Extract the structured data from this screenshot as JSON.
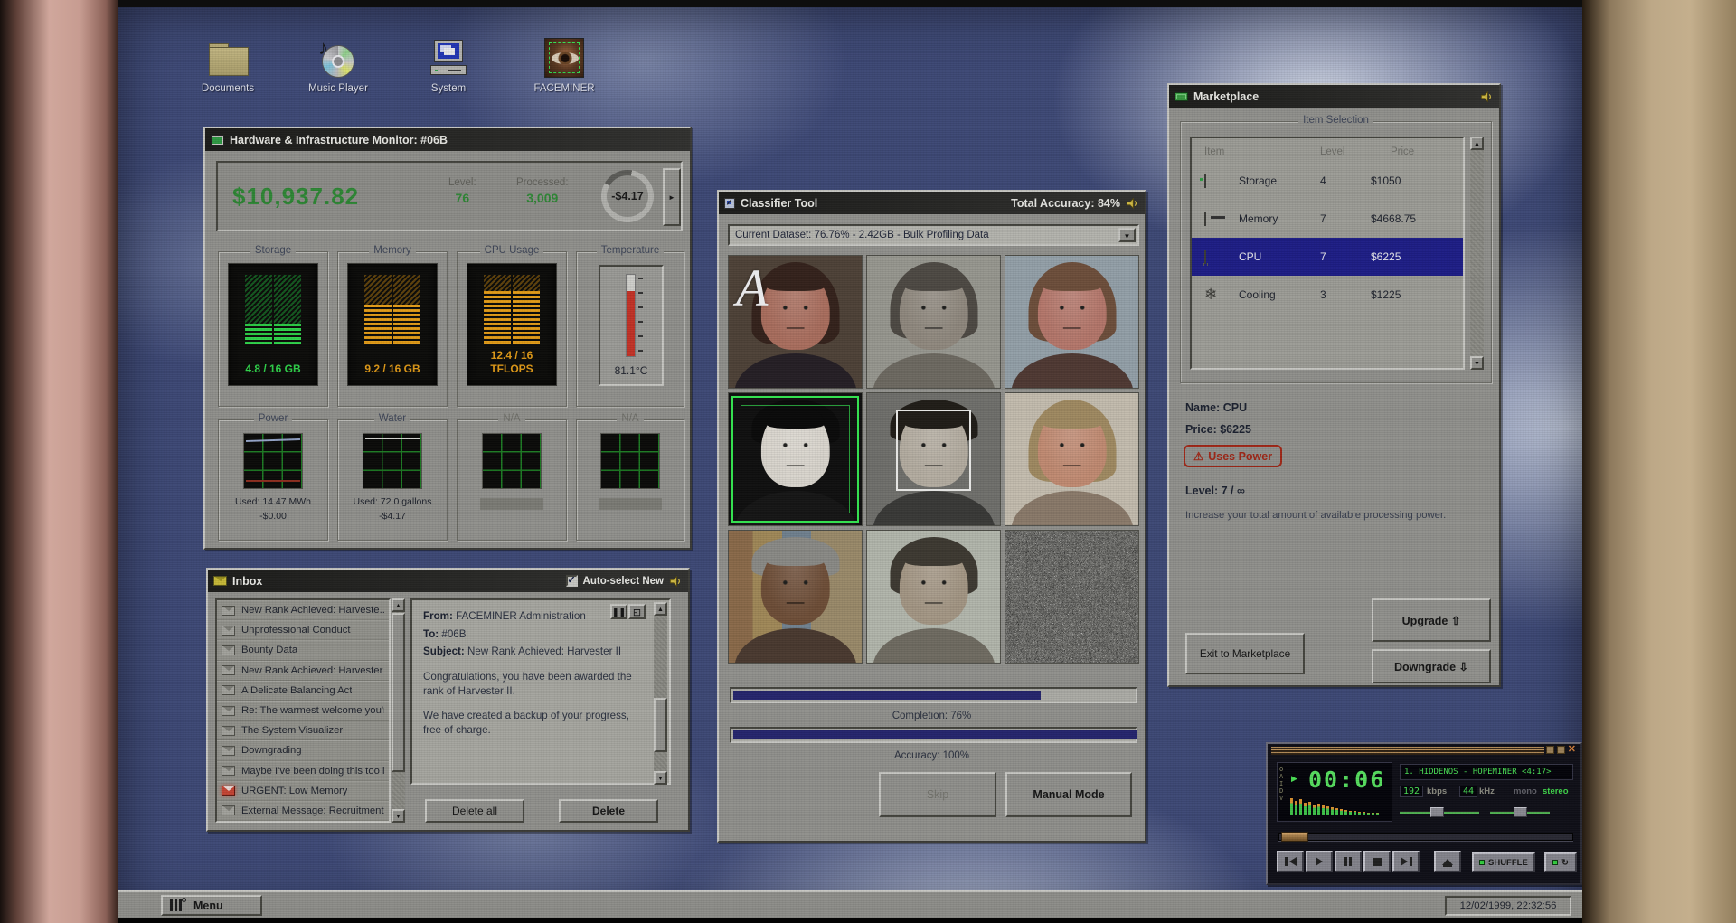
{
  "desktop": {
    "icons": [
      {
        "label": "Documents"
      },
      {
        "label": "Music Player"
      },
      {
        "label": "System"
      },
      {
        "label": "FACEMINER"
      }
    ]
  },
  "hardware": {
    "title": "Hardware & Infrastructure Monitor: #06B",
    "balance": "$10,937.82",
    "level_label": "Level:",
    "level": "76",
    "processed_label": "Processed:",
    "processed": "3,009",
    "rate": "-$4.17",
    "expand_arrow": "►",
    "gauges": [
      {
        "label": "Storage",
        "value": "4.8 / 16 GB"
      },
      {
        "label": "Memory",
        "value": "9.2 / 16 GB"
      },
      {
        "label": "CPU Usage",
        "value": "12.4 / 16",
        "unit": "TFLOPS"
      },
      {
        "label": "Temperature",
        "value": "81.1°C"
      }
    ],
    "meters": [
      {
        "label": "Power",
        "used": "Used: 14.47 MWh",
        "cost": "-$0.00"
      },
      {
        "label": "Water",
        "used": "Used: 72.0 gallons",
        "cost": "-$4.17"
      },
      {
        "label": "N/A"
      },
      {
        "label": "N/A"
      }
    ]
  },
  "inbox": {
    "title": "Inbox",
    "autoselect_label": "Auto-select New",
    "check_glyph": "✓",
    "emails": [
      "New Rank Achieved: Harveste...",
      "Unprofessional Conduct",
      "Bounty Data",
      "New Rank Achieved: Harvester I",
      "A Delicate Balancing Act",
      "Re: The warmest welcome you'r...",
      "The System Visualizer",
      "Downgrading",
      "Maybe I've been doing this too l...",
      "URGENT: Low Memory",
      "External Message: Recruitment"
    ],
    "message": {
      "from_label": "From:",
      "from": "FACEMINER Administration",
      "to_label": "To:",
      "to": "#06B",
      "subject_label": "Subject:",
      "subject": "New Rank Achieved: Harvester II",
      "body1": "Congratulations, you have been awarded the rank of Harvester II.",
      "body2": "We have created a backup of your progress, free of charge."
    },
    "pause_glyph": "❚❚",
    "delete_all": "Delete all",
    "delete": "Delete"
  },
  "classifier": {
    "title": "Classifier Tool",
    "total_accuracy": "Total Accuracy: 84%",
    "dataset": "Current Dataset: 76.76% - 2.42GB - Bulk Profiling Data",
    "drop_glyph": "▼",
    "overlay_letter": "A",
    "completion_label": "Completion: 76%",
    "accuracy_label": "Accuracy: 100%",
    "skip": "Skip",
    "manual_mode": "Manual Mode"
  },
  "marketplace": {
    "title": "Marketplace",
    "section": "Item Selection",
    "columns": [
      "Item",
      "Level",
      "Price"
    ],
    "items": [
      {
        "name": "Storage",
        "level": "4",
        "price": "$1050"
      },
      {
        "name": "Memory",
        "level": "7",
        "price": "$4668.75"
      },
      {
        "name": "CPU",
        "level": "7",
        "price": "$6225"
      },
      {
        "name": "Cooling",
        "level": "3",
        "price": "$1225"
      }
    ],
    "detail": {
      "name_label": "Name:",
      "name": "CPU",
      "price_label": "Price:",
      "price": "$6225",
      "warn_icon": "⚠",
      "warning": "Uses Power",
      "level_label": "Level:",
      "level": "7 / ∞",
      "description": "Increase your total amount of available processing power."
    },
    "upgrade": "Upgrade",
    "upgrade_arrow": "⇧",
    "downgrade": "Downgrade",
    "downgrade_arrow": "⇩",
    "exit": "Exit to Marketplace"
  },
  "player": {
    "clutter": "OAIDV",
    "time": "00:06",
    "track": "1. HIDDENOS - HOPEMINER <4:17>",
    "bitrate": "192",
    "bitrate_unit": "kbps",
    "sample": "44",
    "sample_unit": "kHz",
    "mono": "mono",
    "stereo": "stereo",
    "shuffle": "SHUFFLE",
    "repeat_glyph": "↻",
    "close_glyph": "✕"
  },
  "taskbar": {
    "menu": "Menu",
    "clock": "12/02/1999, 22:32:56"
  }
}
